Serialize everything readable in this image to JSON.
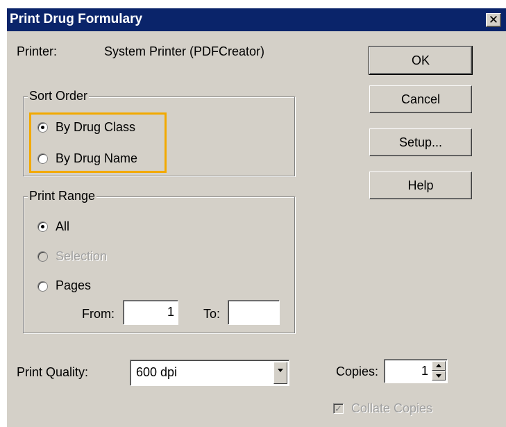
{
  "window": {
    "title": "Print Drug Formulary",
    "close_glyph": "✕"
  },
  "printer": {
    "label": "Printer:",
    "value": "System Printer (PDFCreator)"
  },
  "buttons": {
    "ok": "OK",
    "cancel": "Cancel",
    "setup": "Setup...",
    "help": "Help"
  },
  "sort_order": {
    "legend": "Sort Order",
    "options": [
      {
        "label": "By Drug Class",
        "selected": true
      },
      {
        "label": "By Drug Name",
        "selected": false
      }
    ],
    "highlight_color": "#f2a900"
  },
  "print_range": {
    "legend": "Print Range",
    "options": [
      {
        "label": "All",
        "selected": true,
        "enabled": true
      },
      {
        "label": "Selection",
        "selected": false,
        "enabled": false
      },
      {
        "label": "Pages",
        "selected": false,
        "enabled": true
      }
    ],
    "from_label": "From:",
    "from_value": "1",
    "to_label": "To:",
    "to_value": ""
  },
  "print_quality": {
    "label": "Print Quality:",
    "value": "600 dpi"
  },
  "copies": {
    "label": "Copies:",
    "value": "1",
    "collate_label": "Collate Copies",
    "collate_checked": true,
    "collate_enabled": false
  },
  "colors": {
    "title_bar": "#0a246a",
    "dialog_bg": "#d4d0c8",
    "highlight": "#f2a900"
  }
}
